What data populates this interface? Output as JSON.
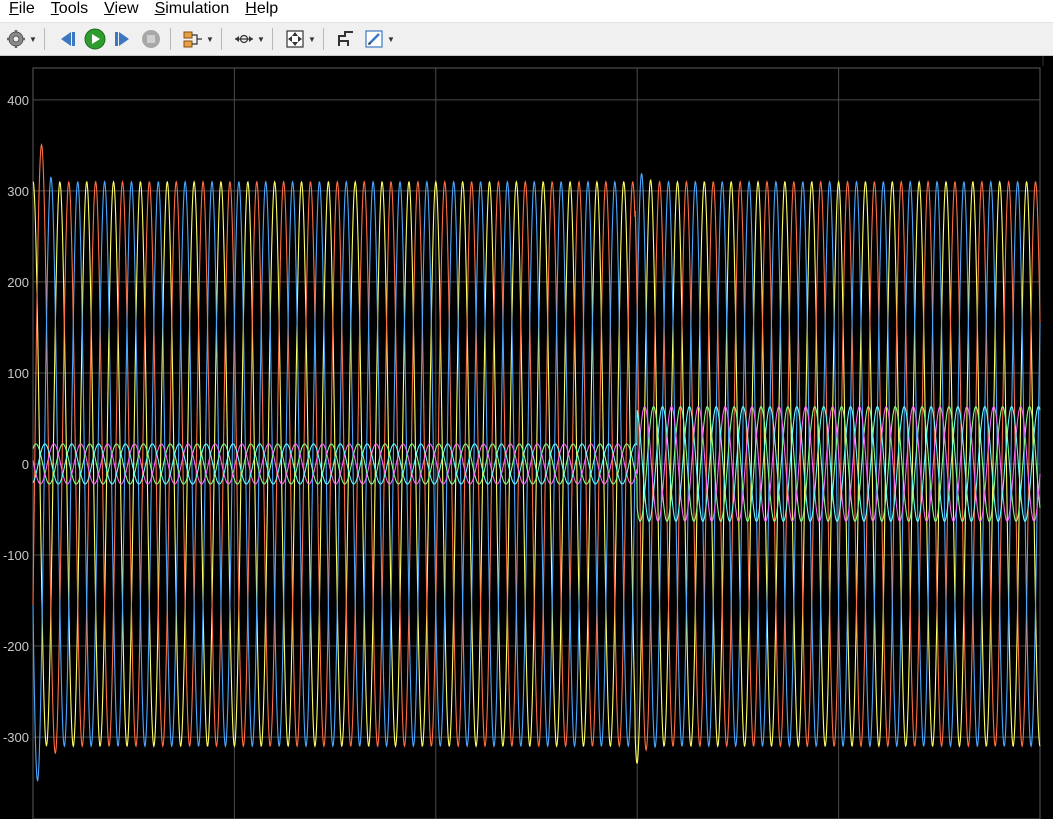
{
  "menu": [
    {
      "label_mn": "F",
      "label_rest": "ile"
    },
    {
      "label_mn": "T",
      "label_rest": "ools"
    },
    {
      "label_mn": "V",
      "label_rest": "iew"
    },
    {
      "label_mn": "S",
      "label_rest": "imulation"
    },
    {
      "label_mn": "H",
      "label_rest": "elp"
    }
  ],
  "toolbar": {
    "icons": [
      "gear-icon",
      "step-back-icon",
      "run-icon",
      "step-forward-icon",
      "stop-icon",
      "signal-highlight-icon",
      "zoom-axes-icon",
      "autoscale-icon",
      "cursor-measure-icon",
      "style-icon"
    ]
  },
  "colors": {
    "background": "#000000",
    "grid": "#4a4a4a",
    "axis_text": "#c8c8c8",
    "series": [
      "#ffff66",
      "#ff6e42",
      "#4aa7ff",
      "#86ff86",
      "#ff66ff",
      "#66ffff"
    ]
  },
  "chart_data": {
    "type": "line",
    "title": "",
    "xlabel": "",
    "ylabel": "",
    "ylim": [
      -390,
      435
    ],
    "yticks": [
      -300,
      -200,
      -100,
      0,
      100,
      200,
      300,
      400
    ],
    "ytick_labels": [
      "-300",
      "-200",
      "-100",
      "0",
      "100",
      "200",
      "300",
      "400"
    ],
    "grid": true,
    "cycles_shown": 37.5,
    "event_fraction": 0.6,
    "series": [
      {
        "color": "#ffff66",
        "amplitude": 310,
        "phase_deg": 90,
        "transient_peak": 335
      },
      {
        "color": "#ff6e42",
        "amplitude": 310,
        "phase_deg": -30,
        "transient_peak": 200
      },
      {
        "color": "#4aa7ff",
        "amplitude": 310,
        "phase_deg": 210,
        "transient_peak": -390
      },
      {
        "color": "#86ff86",
        "amplitude_before": 22,
        "amplitude_after": 63,
        "phase_deg": 50
      },
      {
        "color": "#ff66ff",
        "amplitude_before": 22,
        "amplitude_after": 63,
        "phase_deg": 170
      },
      {
        "color": "#66ffff",
        "amplitude_before": 22,
        "amplitude_after": 63,
        "phase_deg": 290
      }
    ]
  }
}
